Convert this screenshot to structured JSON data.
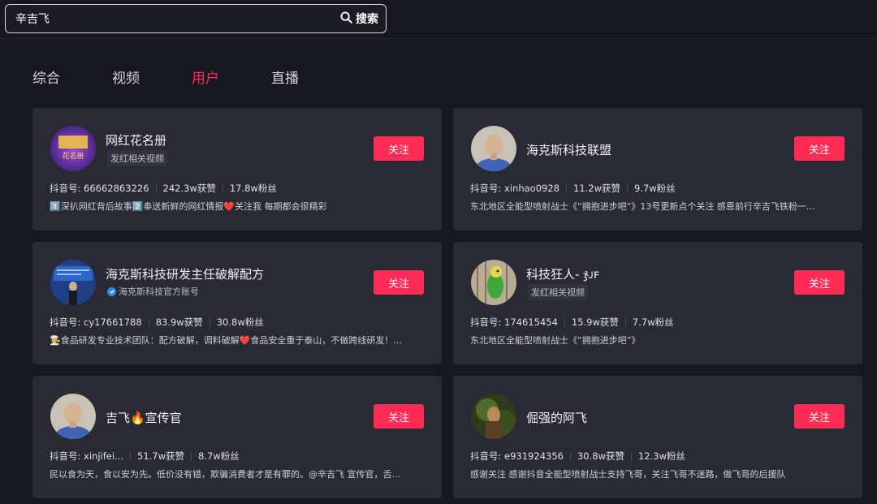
{
  "search": {
    "query": "辛吉飞",
    "button_label": "搜索",
    "icon": "search-icon"
  },
  "tabs": [
    {
      "label": "综合",
      "active": false
    },
    {
      "label": "视频",
      "active": false
    },
    {
      "label": "用户",
      "active": true
    },
    {
      "label": "直播",
      "active": false
    }
  ],
  "colors": {
    "accent": "#fe2c55",
    "background": "#17171f",
    "card": "#2a2a35",
    "verified": "#2b8cf0"
  },
  "users": [
    {
      "name": "网红花名册",
      "subtitle": "发红相关视频",
      "verified": false,
      "follow_label": "关注",
      "douyin_id": "抖音号: 66662863226",
      "likes": "242.3w获赞",
      "fans": "17.8w粉丝",
      "description": "1️⃣深扒网红背后故事2️⃣奉送新鲜的网红情报❤️关注我 每期都会很精彩",
      "avatar_text": "花名册"
    },
    {
      "name": "海克斯科技联盟",
      "subtitle": "",
      "verified": false,
      "follow_label": "关注",
      "douyin_id": "抖音号: xinhao0928",
      "likes": "11.2w获赞",
      "fans": "9.7w粉丝",
      "description": "东北地区全能型喷射战士《“拥抱进步吧”》13号更新点个关注 感恩前行辛吉飞铁粉一…"
    },
    {
      "name": "海克斯科技研发主任破解配方",
      "subtitle": "海克斯科技官方账号",
      "verified": true,
      "follow_label": "关注",
      "douyin_id": "抖音号: cy17661788",
      "likes": "83.9w获赞",
      "fans": "30.8w粉丝",
      "description": "👩‍🍳食品研发专业技术团队：配方破解，调料破解❤️食品安全重于泰山，不做跨线研发！…"
    },
    {
      "name": "科技狂人- ჯᴊꜰ",
      "subtitle": "发红相关视频",
      "verified": false,
      "follow_label": "关注",
      "douyin_id": "抖音号: 174615454",
      "likes": "15.9w获赞",
      "fans": "7.7w粉丝",
      "description": "东北地区全能型喷射战士《“拥抱进步吧”》"
    },
    {
      "name": "吉飞🔥宣传官",
      "subtitle": "",
      "verified": false,
      "follow_label": "关注",
      "douyin_id": "抖音号: xinjifei...",
      "likes": "51.7w获赞",
      "fans": "8.7w粉丝",
      "description": "民以食为天，食以安为先。低价没有错，欺骗消费者才是有罪的。@辛吉飞 宣传官，舌…"
    },
    {
      "name": "倔强的阿飞",
      "subtitle": "",
      "verified": false,
      "follow_label": "关注",
      "douyin_id": "抖音号: e931924356",
      "likes": "30.8w获赞",
      "fans": "12.3w粉丝",
      "description": "感谢关注 感谢抖音全能型喷射战士支持飞哥，关注飞哥不迷路，做飞哥的后援队"
    }
  ]
}
